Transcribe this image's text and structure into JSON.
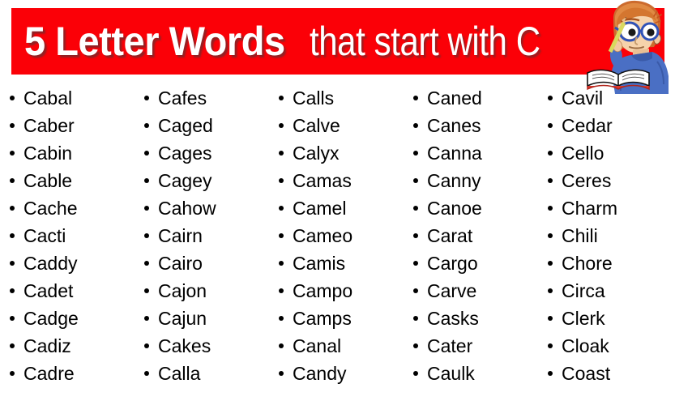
{
  "header": {
    "title_strong": "5 Letter Words",
    "title_light": "that start with C",
    "banner_color": "#fb0007",
    "title_color": "#ffffff",
    "mascot_icon": "boy-studying-with-book-icon"
  },
  "columns": [
    {
      "name": "column-1",
      "words": [
        "Cabal",
        "Caber",
        "Cabin",
        "Cable",
        "Cache",
        "Cacti",
        "Caddy",
        "Cadet",
        "Cadge",
        "Cadiz",
        "Cadre"
      ]
    },
    {
      "name": "column-2",
      "words": [
        "Cafes",
        "Caged",
        "Cages",
        "Cagey",
        "Cahow",
        "Cairn",
        "Cairo",
        "Cajon",
        "Cajun",
        "Cakes",
        "Calla"
      ]
    },
    {
      "name": "column-3",
      "words": [
        "Calls",
        "Calve",
        "Calyx",
        "Camas",
        "Camel",
        "Cameo",
        "Camis",
        "Campo",
        "Camps",
        "Canal",
        "Candy"
      ]
    },
    {
      "name": "column-4",
      "words": [
        "Caned",
        "Canes",
        "Canna",
        "Canny",
        "Canoe",
        "Carat",
        "Cargo",
        "Carve",
        "Casks",
        "Cater",
        "Caulk"
      ]
    },
    {
      "name": "column-5",
      "words": [
        "Cavil",
        "Cedar",
        "Cello",
        "Ceres",
        "Charm",
        "Chili",
        "Chore",
        "Circa",
        "Clerk",
        "Cloak",
        "Coast"
      ]
    }
  ],
  "text_color": "#000000",
  "background_color": "#ffffff"
}
